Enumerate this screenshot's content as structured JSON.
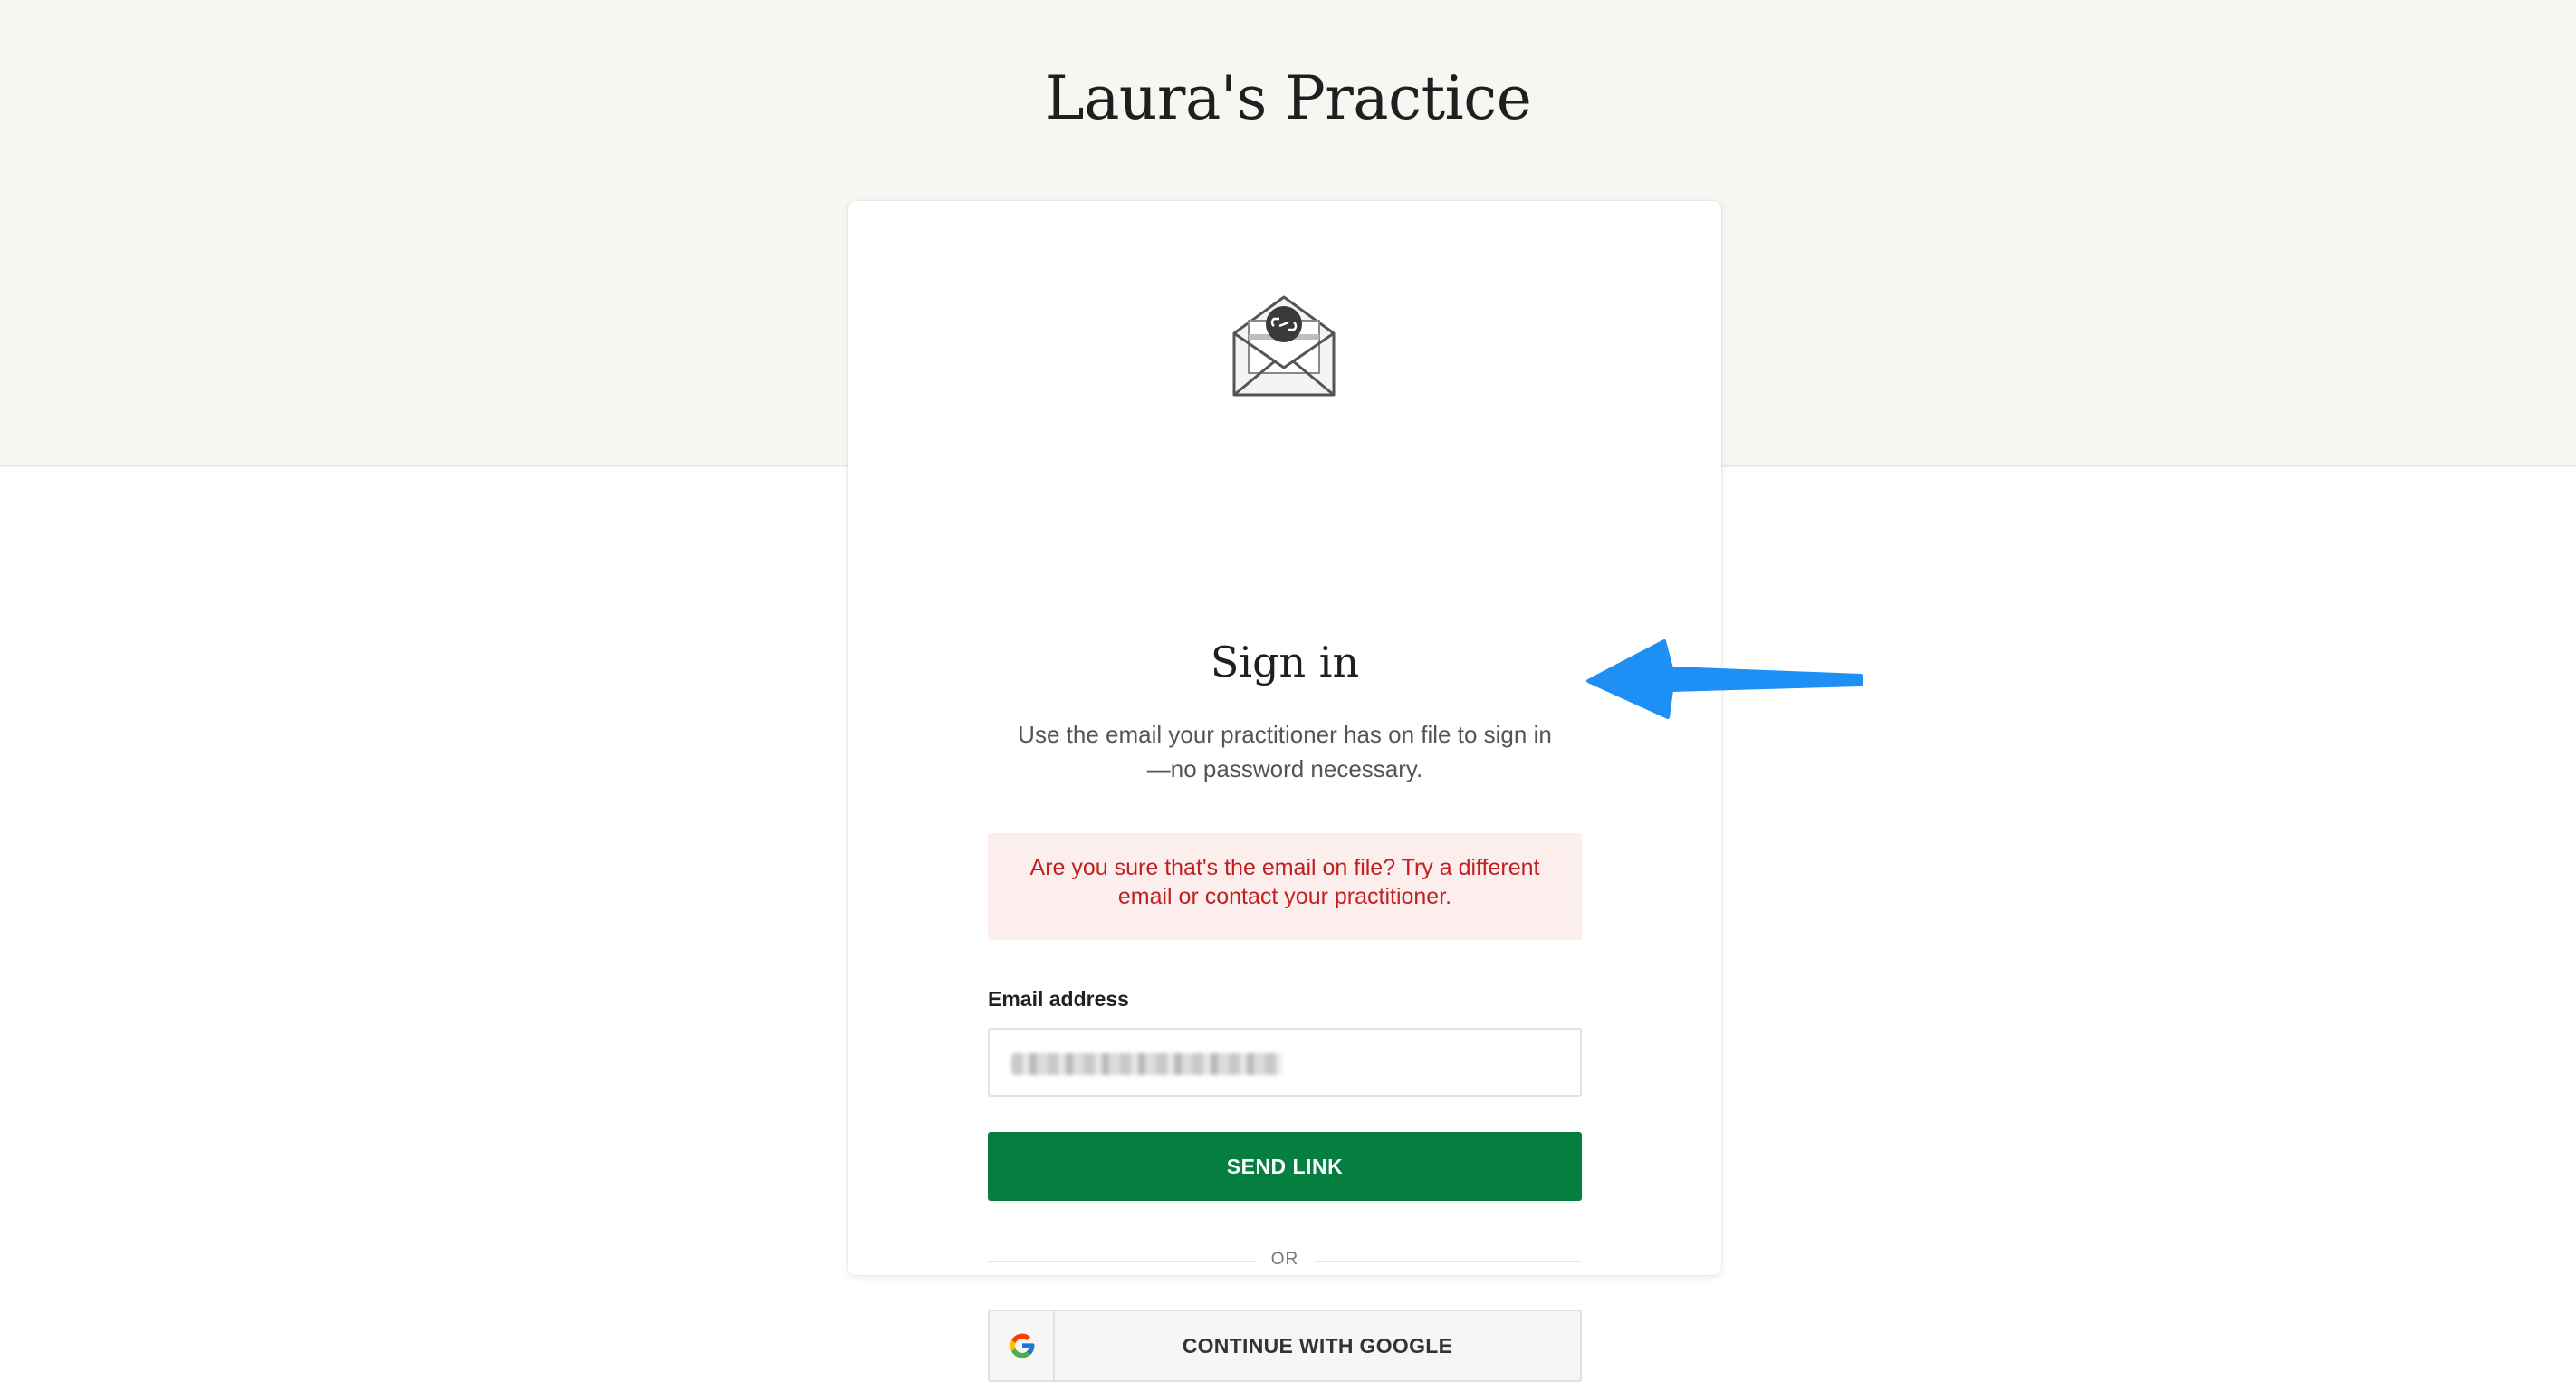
{
  "header": {
    "practice_name": "Laura's Practice"
  },
  "signin": {
    "heading": "Sign in",
    "subtitle": "Use the email your practitioner has on file to sign in—no password necessary.",
    "error_message": "Are you sure that's the email on file? Try a different email or contact your practitioner.",
    "email_label": "Email address",
    "send_button_label": "SEND LINK",
    "divider_label": "OR",
    "google_button_label": "CONTINUE WITH GOOGLE"
  },
  "icons": {
    "envelope": "envelope-link-icon",
    "google": "google-icon",
    "annotation": "arrow-icon"
  },
  "colors": {
    "band_background": "#f7f6f2",
    "primary_button": "#047f40",
    "error_background": "#fdeeee",
    "error_text": "#c21f1f",
    "annotation_arrow": "#1e8ff5"
  }
}
